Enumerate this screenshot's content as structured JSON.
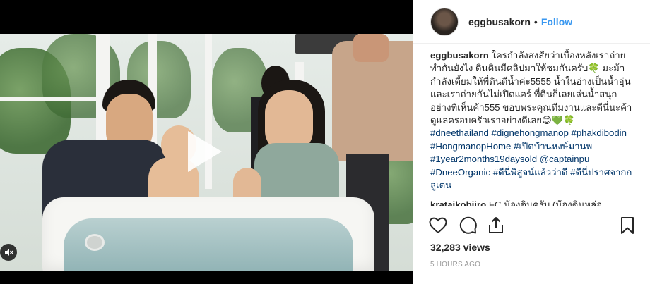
{
  "post": {
    "username": "eggbusakorn",
    "dot": "•",
    "follow_label": "Follow"
  },
  "caption": {
    "username": "eggbusakorn",
    "text": "ใครกำลังสงสัยว่าเบื้องหลังเราถ่ายทำกันยังไง ดินดินมีคลิปมาให้ชมกันครับ🍀 มะม้ากำลังเตี้ยมให้พี่ดินตีน้ำค่ะ5555 น้ำในอ่างเป็นน้ำอุ่น และเราถ่ายกันไม่เปิดแอร์ พี่ดินก็เลยเล่นน้ำสนุกอย่างที่เห็นค้า555 ขอบพระคุณทีมงานและดีนี่นะค้าดูแลครอบครัวเราอย่างดีเลย😊💚🍀",
    "tags": [
      "#dneethailand",
      "#dignehongmanop",
      "#phakdibodin",
      "#HongmanopHome",
      "#เปิดบ้านหงษ์มานพ",
      "#1year2months19daysold"
    ],
    "mention": "@captainpu",
    "tags2": [
      "#DneeOrganic",
      "#ดีนี่พิสูจน์แล้วว่าดี",
      "#ดีนี่ปราศจากกลูเตน"
    ]
  },
  "next_comment": {
    "username": "krataikobjiro",
    "text": "FC น้องดินครับ (น้องดินหล่อ"
  },
  "icons": {
    "like": "heart-icon",
    "comment": "comment-bubble-icon",
    "share": "share-icon",
    "save": "bookmark-icon",
    "play": "play-icon",
    "sound": "speaker-muted-icon"
  },
  "stats": {
    "views": "32,283 views",
    "timestamp": "5 HOURS AGO"
  },
  "colors": {
    "link": "#3897f0",
    "hashtag": "#003569",
    "muted": "#999999"
  }
}
